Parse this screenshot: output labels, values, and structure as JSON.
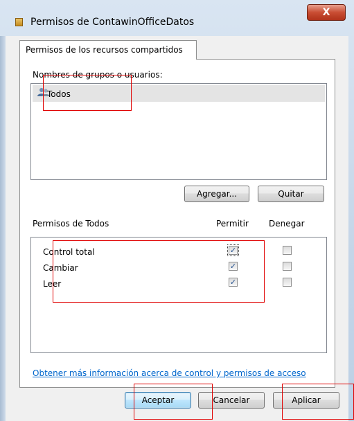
{
  "window": {
    "title": "Permisos de ContawinOfficeDatos",
    "close_glyph": "X"
  },
  "tabs": [
    {
      "label": "Permisos de los recursos compartidos"
    }
  ],
  "groups": {
    "label": "Nombres de grupos o usuarios:",
    "items": [
      {
        "name": "Todos",
        "icon": "users-icon",
        "selected": true
      }
    ]
  },
  "buttons": {
    "add": "Agregar...",
    "remove": "Quitar",
    "ok": "Aceptar",
    "cancel": "Cancelar",
    "apply": "Aplicar"
  },
  "permissions": {
    "title": "Permisos de Todos",
    "allow_header": "Permitir",
    "deny_header": "Denegar",
    "rows": [
      {
        "name": "Control total",
        "allow": true,
        "deny": false
      },
      {
        "name": "Cambiar",
        "allow": true,
        "deny": false
      },
      {
        "name": "Leer",
        "allow": true,
        "deny": false
      }
    ]
  },
  "help_link": "Obtener más información acerca de control y permisos de acceso",
  "colors": {
    "link": "#0066cc",
    "annotation": "#e00000"
  }
}
